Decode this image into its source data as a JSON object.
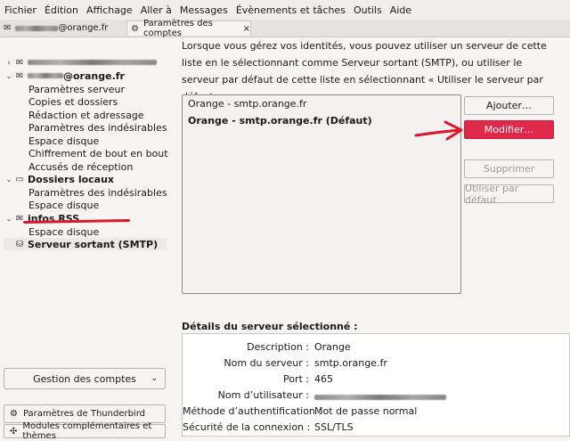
{
  "menubar": [
    "Fichier",
    "Édition",
    "Affichage",
    "Aller à",
    "Messages",
    "Évènements et tâches",
    "Outils",
    "Aide"
  ],
  "tabs": [
    {
      "label": "@orange.fr",
      "icon": "mail-icon"
    },
    {
      "label": "Paramètres des comptes",
      "icon": "gear-icon",
      "close": "×"
    }
  ],
  "sidebar": {
    "account_orange_suffix": "@orange.fr",
    "orange_items": [
      "Paramètres serveur",
      "Copies et dossiers",
      "Rédaction et adressage",
      "Paramètres des indésirables",
      "Espace disque",
      "Chiffrement de bout en bout",
      "Accusés de réception"
    ],
    "local_folders": "Dossiers locaux",
    "local_items": [
      "Paramètres des indésirables",
      "Espace disque"
    ],
    "rss": "infos RSS",
    "rss_items": [
      "Espace disque"
    ],
    "outgoing": "Serveur sortant (SMTP)",
    "manage_accounts": "Gestion des comptes",
    "thunderbird_settings": "Paramètres de Thunderbird",
    "addons": "Modules complémentaires et thèmes"
  },
  "main": {
    "intro": "Lorsque vous gérez vos identités, vous pouvez utiliser un serveur de cette liste en le sélectionnant comme Serveur sortant (SMTP), ou utiliser le serveur par défaut de cette liste en sélectionnant « Utiliser le serveur par défaut ».",
    "servers": [
      "Orange - smtp.orange.fr",
      "Orange - smtp.orange.fr (Défaut)"
    ],
    "buttons": {
      "add": "Ajouter…",
      "edit": "Modifier…",
      "delete": "Supprimer",
      "use_default": "Utiliser par défaut"
    },
    "details_title": "Détails du serveur sélectionné :",
    "details": [
      {
        "label": "Description :",
        "value": "Orange"
      },
      {
        "label": "Nom du serveur :",
        "value": "smtp.orange.fr"
      },
      {
        "label": "Port :",
        "value": "465"
      },
      {
        "label": "Nom d’utilisateur :",
        "value": ""
      },
      {
        "label": "Méthode d’authentification :",
        "value": "Mot de passe normal"
      },
      {
        "label": "Sécurité de la connexion :",
        "value": "SSL/TLS"
      }
    ]
  },
  "colors": {
    "accent": "#e0284a",
    "annotation": "#e0162c"
  }
}
